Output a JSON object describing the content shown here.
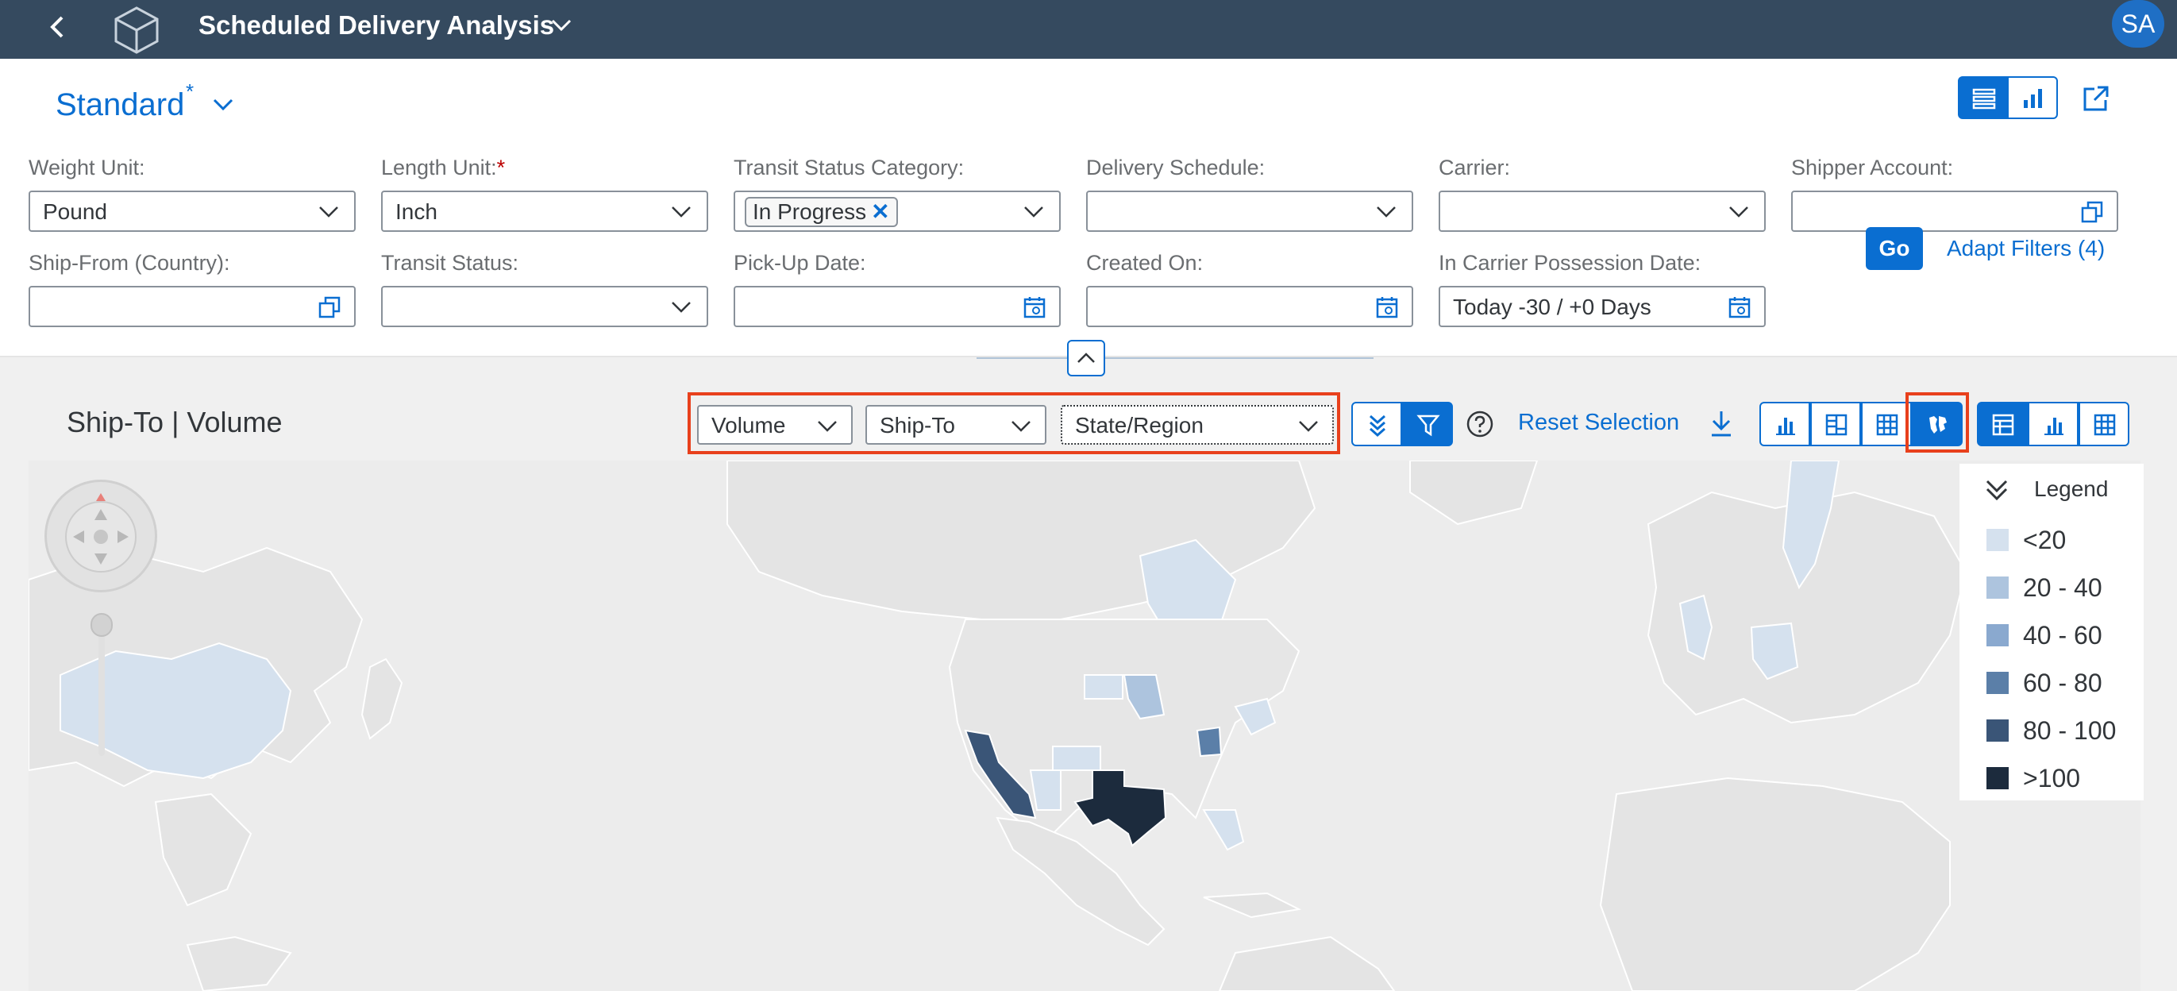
{
  "shell": {
    "title": "Scheduled Delivery Analysis",
    "avatar": "SA"
  },
  "variant": {
    "name": "Standard",
    "modified_marker": "*"
  },
  "filters": [
    {
      "label": "Weight Unit:",
      "value": "Pound",
      "type": "select"
    },
    {
      "label": "Length Unit:",
      "required": "*",
      "value": "Inch",
      "type": "select"
    },
    {
      "label": "Transit Status Category:",
      "token": "In Progress",
      "type": "multi"
    },
    {
      "label": "Delivery Schedule:",
      "value": "",
      "type": "select"
    },
    {
      "label": "Carrier:",
      "value": "",
      "type": "select"
    },
    {
      "label": "Shipper Account:",
      "value": "",
      "type": "value-help"
    },
    {
      "label": "Ship-From (Country):",
      "value": "",
      "type": "value-help"
    },
    {
      "label": "Transit Status:",
      "value": "",
      "type": "select"
    },
    {
      "label": "Pick-Up Date:",
      "value": "",
      "type": "date"
    },
    {
      "label": "Created On:",
      "value": "",
      "type": "date"
    },
    {
      "label": "In Carrier Possession Date:",
      "value": "Today -30 / +0 Days",
      "type": "date"
    }
  ],
  "actions": {
    "go": "Go",
    "adapt_filters": "Adapt Filters (4)"
  },
  "chart": {
    "title": "Ship-To | Volume",
    "measure": "Volume",
    "dimension": "Ship-To",
    "level": "State/Region",
    "reset": "Reset Selection"
  },
  "legend": {
    "title": "Legend",
    "items": [
      {
        "label": "<20",
        "color": "#d5e1ee"
      },
      {
        "label": "20 - 40",
        "color": "#adc4de"
      },
      {
        "label": "40 - 60",
        "color": "#8aa9cf"
      },
      {
        "label": "60 - 80",
        "color": "#5b7fa8"
      },
      {
        "label": "80 - 100",
        "color": "#3a5577"
      },
      {
        "label": ">100",
        "color": "#1c2b3d"
      }
    ]
  },
  "icons": [
    "back-icon",
    "app-logo-icon",
    "chevron-down-icon",
    "share-icon",
    "value-help-icon",
    "calendar-icon",
    "collapse-icon",
    "drill-down-icon",
    "filter-icon",
    "help-icon",
    "download-icon",
    "bar-chart-icon",
    "map-icon",
    "table-icon",
    "compass-icon"
  ]
}
